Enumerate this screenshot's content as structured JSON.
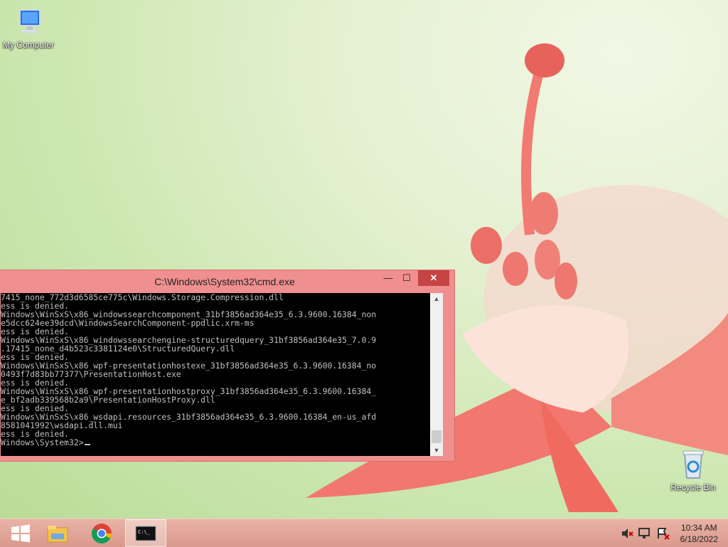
{
  "desktop": {
    "icons": [
      {
        "label": "My Computer"
      },
      {
        "label": "Recycle Bin"
      }
    ]
  },
  "cmd_window": {
    "title": "C:\\Windows\\System32\\cmd.exe",
    "buttons": {
      "minimize": "—",
      "maximize": "☐",
      "close": "✕"
    },
    "lines": [
      "7415_none_772d3d6585ce775c\\Windows.Storage.Compression.dll",
      "ess is denied.",
      "Windows\\WinSxS\\x86_windowssearchcomponent_31bf3856ad364e35_6.3.9600.16384_non",
      "e5dcc624ee39dcd\\WindowsSearchComponent-ppdlic.xrm-ms",
      "ess is denied.",
      "Windows\\WinSxS\\x86_windowssearchengine-structuredquery_31bf3856ad364e35_7.0.9",
      ".17415_none_d4b523c3381124e0\\StructuredQuery.dll",
      "ess is denied.",
      "Windows\\WinSxS\\x86_wpf-presentationhostexe_31bf3856ad364e35_6.3.9600.16384_no",
      "0493f7d83bb77377\\PresentationHost.exe",
      "ess is denied.",
      "Windows\\WinSxS\\x86_wpf-presentationhostproxy_31bf3856ad364e35_6.3.9600.16384_",
      "e_bf2adb339568b2a9\\PresentationHostProxy.dll",
      "ess is denied.",
      "Windows\\WinSxS\\x86_wsdapi.resources_31bf3856ad364e35_6.3.9600.16384_en-us_afd",
      "8581041992\\wsdapi.dll.mui",
      "ess is denied.",
      ""
    ],
    "prompt": "Windows\\System32>"
  },
  "taskbar": {
    "items": [
      {
        "icon": "windows-start-icon"
      },
      {
        "icon": "file-explorer-icon"
      },
      {
        "icon": "chrome-icon"
      },
      {
        "icon": "command-prompt-icon",
        "active": true
      }
    ],
    "tray_icons": [
      "volume-muted-icon",
      "network-icon",
      "action-center-icon"
    ],
    "clock": {
      "time": "10:34 AM",
      "date": "6/18/2022"
    }
  },
  "colors": {
    "window_frame": "#f08f8f",
    "close_button": "#c74444",
    "console_bg": "#000000",
    "console_text": "#c0c0c0"
  }
}
